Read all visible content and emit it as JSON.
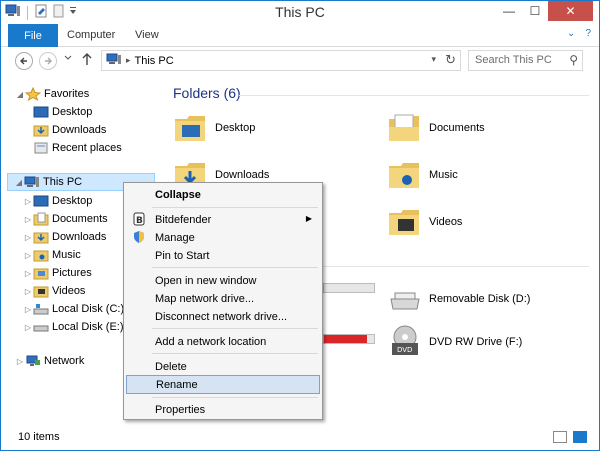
{
  "window": {
    "title": "This PC",
    "controls": {
      "minimize": "—",
      "maximize": "☐",
      "close": "✕"
    }
  },
  "ribbon": {
    "file": "File",
    "computer": "Computer",
    "view": "View",
    "expand": "⌄",
    "help": "?"
  },
  "navbar": {
    "path": "This PC",
    "search_placeholder": "Search This PC"
  },
  "navpane": {
    "favorites": "Favorites",
    "fav_items": [
      "Desktop",
      "Downloads",
      "Recent places"
    ],
    "this_pc": "This PC",
    "pc_items": [
      "Desktop",
      "Documents",
      "Downloads",
      "Music",
      "Pictures",
      "Videos",
      "Local Disk (C:)",
      "Local Disk (E:)"
    ],
    "network": "Network"
  },
  "content": {
    "folders_title": "Folders (6)",
    "folders": [
      "Desktop",
      "Documents",
      "Downloads",
      "Music",
      "Videos"
    ],
    "drives": [
      "Removable Disk (D:)",
      "DVD RW Drive (F:)"
    ]
  },
  "context_menu": {
    "collapse": "Collapse",
    "bitdefender": "Bitdefender",
    "manage": "Manage",
    "pin_to_start": "Pin to Start",
    "open_new_window": "Open in new window",
    "map_network_drive": "Map network drive...",
    "disconnect_network_drive": "Disconnect network drive...",
    "add_network_location": "Add a network location",
    "delete": "Delete",
    "rename": "Rename",
    "properties": "Properties"
  },
  "status": {
    "items": "10 items"
  },
  "colors": {
    "accent": "#1979ca",
    "folder_title": "#1e3287",
    "bar_fill": "#da2626"
  }
}
